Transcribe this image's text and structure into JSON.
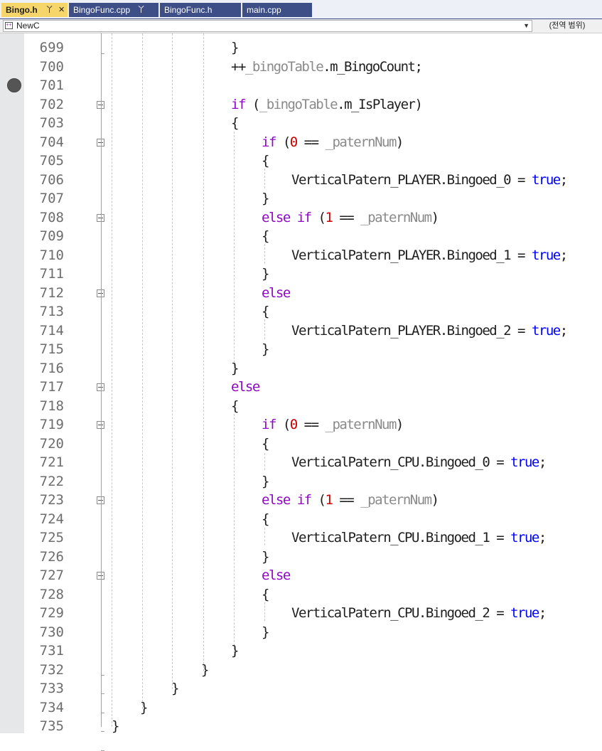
{
  "tabs": [
    {
      "label": "Bingo.h",
      "pin": "pin-icon",
      "close": "close-icon",
      "active": true
    },
    {
      "label": "BingoFunc.cpp",
      "pin": "pin-icon"
    },
    {
      "label": "BingoFunc.h"
    },
    {
      "label": "main.cpp"
    }
  ],
  "navbar": {
    "scope_value": "NewC",
    "member_value": "(전역 범위)"
  },
  "editor": {
    "breakpoint_line": 701,
    "lines": [
      {
        "n": "699",
        "t": [
          [
            "}",
            ""
          ]
        ]
      },
      {
        "n": "700",
        "t": [
          [
            "++",
            ""
          ],
          [
            "_bingoTable",
            "mem"
          ],
          [
            ".m_BingoCount;",
            ""
          ]
        ]
      },
      {
        "n": "701",
        "t": []
      },
      {
        "n": "702",
        "t": [
          [
            "if",
            "kw"
          ],
          [
            " (",
            ""
          ],
          [
            "_bingoTable",
            "mem"
          ],
          [
            ".m_IsPlayer)",
            ""
          ]
        ]
      },
      {
        "n": "703",
        "t": [
          [
            "{",
            ""
          ]
        ]
      },
      {
        "n": "704",
        "t": [
          [
            "if",
            "kw"
          ],
          [
            " (",
            ""
          ],
          [
            "0",
            "num"
          ],
          [
            " == ",
            ""
          ],
          [
            "_paternNum",
            "mem"
          ],
          [
            ")",
            ""
          ]
        ]
      },
      {
        "n": "705",
        "t": [
          [
            "{",
            ""
          ]
        ]
      },
      {
        "n": "706",
        "t": [
          [
            "VerticalPatern_PLAYER.Bingoed_0 = ",
            ""
          ],
          [
            "true",
            "bool"
          ],
          [
            ";",
            ""
          ]
        ]
      },
      {
        "n": "707",
        "t": [
          [
            "}",
            ""
          ]
        ]
      },
      {
        "n": "708",
        "t": [
          [
            "else if",
            "kw"
          ],
          [
            " (",
            ""
          ],
          [
            "1",
            "num"
          ],
          [
            " == ",
            ""
          ],
          [
            "_paternNum",
            "mem"
          ],
          [
            ")",
            ""
          ]
        ]
      },
      {
        "n": "709",
        "t": [
          [
            "{",
            ""
          ]
        ]
      },
      {
        "n": "710",
        "t": [
          [
            "VerticalPatern_PLAYER.Bingoed_1 = ",
            ""
          ],
          [
            "true",
            "bool"
          ],
          [
            ";",
            ""
          ]
        ]
      },
      {
        "n": "711",
        "t": [
          [
            "}",
            ""
          ]
        ]
      },
      {
        "n": "712",
        "t": [
          [
            "else",
            "kw"
          ]
        ]
      },
      {
        "n": "713",
        "t": [
          [
            "{",
            ""
          ]
        ]
      },
      {
        "n": "714",
        "t": [
          [
            "VerticalPatern_PLAYER.Bingoed_2 = ",
            ""
          ],
          [
            "true",
            "bool"
          ],
          [
            ";",
            ""
          ]
        ]
      },
      {
        "n": "715",
        "t": [
          [
            "}",
            ""
          ]
        ]
      },
      {
        "n": "716",
        "t": [
          [
            "}",
            ""
          ]
        ]
      },
      {
        "n": "717",
        "t": [
          [
            "else",
            "kw"
          ]
        ]
      },
      {
        "n": "718",
        "t": [
          [
            "{",
            ""
          ]
        ]
      },
      {
        "n": "719",
        "t": [
          [
            "if",
            "kw"
          ],
          [
            " (",
            ""
          ],
          [
            "0",
            "num"
          ],
          [
            " == ",
            ""
          ],
          [
            "_paternNum",
            "mem"
          ],
          [
            ")",
            ""
          ]
        ]
      },
      {
        "n": "720",
        "t": [
          [
            "{",
            ""
          ]
        ]
      },
      {
        "n": "721",
        "t": [
          [
            "VerticalPatern_CPU.Bingoed_0 = ",
            ""
          ],
          [
            "true",
            "bool"
          ],
          [
            ";",
            ""
          ]
        ]
      },
      {
        "n": "722",
        "t": [
          [
            "}",
            ""
          ]
        ]
      },
      {
        "n": "723",
        "t": [
          [
            "else if",
            "kw"
          ],
          [
            " (",
            ""
          ],
          [
            "1",
            "num"
          ],
          [
            " == ",
            ""
          ],
          [
            "_paternNum",
            "mem"
          ],
          [
            ")",
            ""
          ]
        ]
      },
      {
        "n": "724",
        "t": [
          [
            "{",
            ""
          ]
        ]
      },
      {
        "n": "725",
        "t": [
          [
            "VerticalPatern_CPU.Bingoed_1 = ",
            ""
          ],
          [
            "true",
            "bool"
          ],
          [
            ";",
            ""
          ]
        ]
      },
      {
        "n": "726",
        "t": [
          [
            "}",
            ""
          ]
        ]
      },
      {
        "n": "727",
        "t": [
          [
            "else",
            "kw"
          ]
        ]
      },
      {
        "n": "728",
        "t": [
          [
            "{",
            ""
          ]
        ]
      },
      {
        "n": "729",
        "t": [
          [
            "VerticalPatern_CPU.Bingoed_2 = ",
            ""
          ],
          [
            "true",
            "bool"
          ],
          [
            ";",
            ""
          ]
        ]
      },
      {
        "n": "730",
        "t": [
          [
            "}",
            ""
          ]
        ]
      },
      {
        "n": "731",
        "t": [
          [
            "}",
            ""
          ]
        ]
      },
      {
        "n": "732",
        "t": [
          [
            "}",
            ""
          ]
        ]
      },
      {
        "n": "733",
        "t": [
          [
            "}",
            ""
          ]
        ]
      },
      {
        "n": "734",
        "t": [
          [
            "}",
            ""
          ]
        ]
      },
      {
        "n": "735",
        "t": [
          [
            "}",
            ""
          ]
        ]
      }
    ]
  }
}
